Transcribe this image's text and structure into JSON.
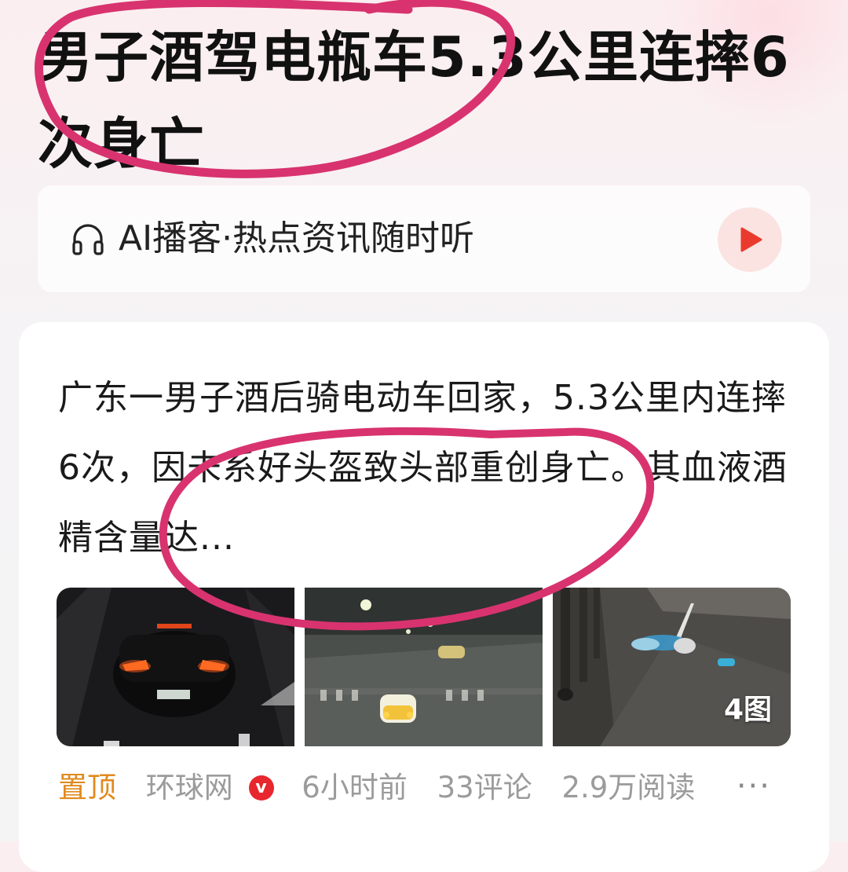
{
  "article": {
    "headline": "男子酒驾电瓶车5.3公里连摔6次身亡"
  },
  "podcast": {
    "icon": "headphones-icon",
    "label": "AI播客·热点资讯随时听",
    "play_icon": "play-icon"
  },
  "card": {
    "summary": "广东一男子酒后骑电动车回家，5.3公里内连摔6次，因未系好头盔致头部重创身亡。其血液酒精含量达...",
    "image_count_label": "4图",
    "meta": {
      "pinned": "置顶",
      "source": "环球网",
      "verified_badge": "v",
      "time": "6小时前",
      "comments": "33评论",
      "reads": "2.9万阅读",
      "more": "···"
    }
  },
  "colors": {
    "pinned": "#e08a1e",
    "verified": "#e8262d",
    "play": "#ea3a2e",
    "annotation": "#d8336f"
  }
}
